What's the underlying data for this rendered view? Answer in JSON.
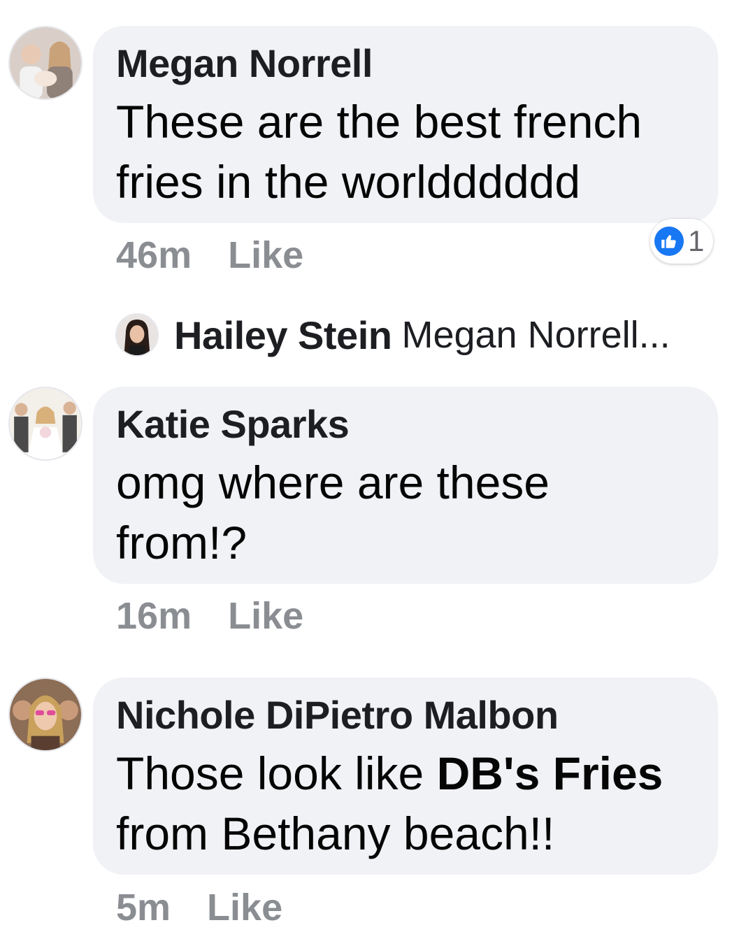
{
  "comments": [
    {
      "author": "Megan Norrell",
      "text_line1": "These are the best french",
      "text_line2": "fries in the worldddddd",
      "time": "46m",
      "like_label": "Like",
      "reaction_count": "1"
    },
    {
      "author": "Katie Sparks",
      "text_line1": "omg where are these",
      "text_line2": "from!?",
      "time": "16m",
      "like_label": "Like"
    },
    {
      "author": "Nichole DiPietro Malbon",
      "text_line1_pre": "Those look like ",
      "text_line1_tag": "DB's Fries",
      "text_line2": "from Bethany beach!!",
      "time": "5m",
      "like_label": "Like"
    }
  ],
  "reply": {
    "author": "Hailey Stein",
    "preview": "Megan Norrell..."
  },
  "colors": {
    "bubble": "#f0f2f5",
    "meta_text": "#8a8d91",
    "like_blue": "#1877f2"
  },
  "icons": {
    "reaction": "thumbs-up-icon"
  }
}
